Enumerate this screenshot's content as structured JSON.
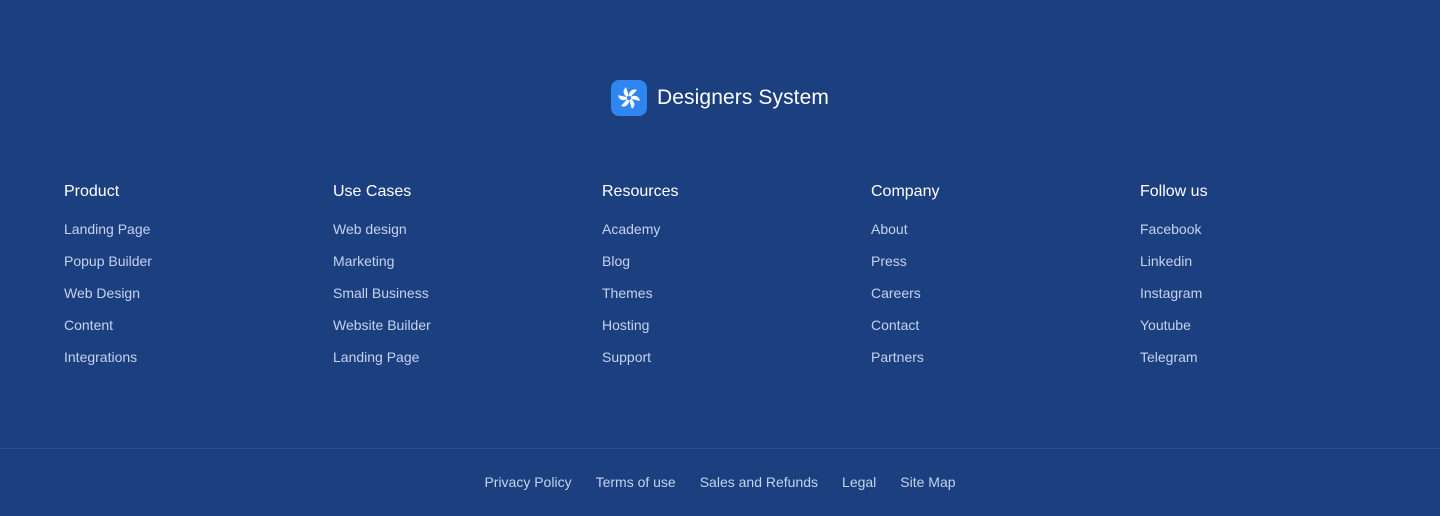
{
  "brand": {
    "name": "Designers System",
    "icon": "pinwheel-logo-icon",
    "accent_color": "#2f86f0"
  },
  "columns": [
    {
      "title": "Product",
      "links": [
        "Landing Page",
        "Popup Builder",
        "Web Design",
        "Content",
        "Integrations"
      ]
    },
    {
      "title": "Use Cases",
      "links": [
        "Web design",
        "Marketing",
        "Small Business",
        "Website Builder",
        "Landing Page"
      ]
    },
    {
      "title": "Resources",
      "links": [
        "Academy",
        "Blog",
        "Themes",
        "Hosting",
        "Support"
      ]
    },
    {
      "title": "Company",
      "links": [
        "About",
        "Press",
        "Careers",
        "Contact",
        "Partners"
      ]
    },
    {
      "title": "Follow us",
      "links": [
        "Facebook",
        "Linkedin",
        "Instagram",
        "Youtube",
        "Telegram"
      ]
    }
  ],
  "bottom_links": [
    "Privacy Policy",
    "Terms of use",
    "Sales and Refunds",
    "Legal",
    "Site Map"
  ],
  "colors": {
    "background": "#1b3f7f",
    "heading": "#ffffff",
    "link": "#c5d3ee"
  }
}
